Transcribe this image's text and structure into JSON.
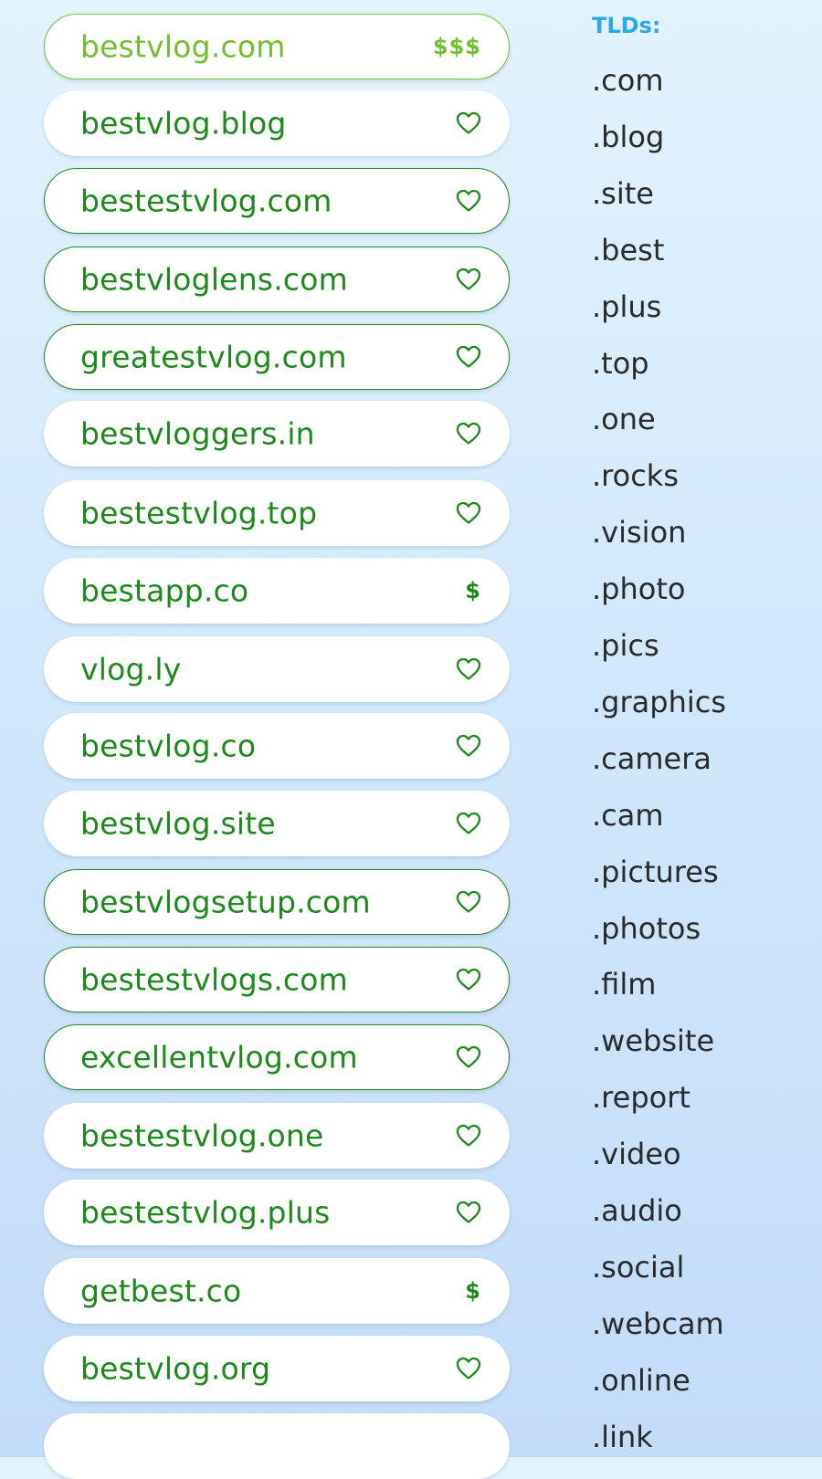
{
  "colors": {
    "domain_text": "#1b8a1b",
    "premium_text": "#72c030",
    "tld_heading": "#2ba8e8",
    "tld_text": "#2a2a2a",
    "background_top": "#e3f3fd",
    "background_bottom": "#c3dcf8"
  },
  "domains": [
    {
      "name": "bestvlog.com",
      "icon": "price-tag",
      "price": "$$$",
      "style": "premium"
    },
    {
      "name": "bestvlog.blog",
      "icon": "heart-icon",
      "style": "plain"
    },
    {
      "name": "bestestvlog.com",
      "icon": "heart-icon",
      "style": "outlined"
    },
    {
      "name": "bestvloglens.com",
      "icon": "heart-icon",
      "style": "outlined"
    },
    {
      "name": "greatestvlog.com",
      "icon": "heart-icon",
      "style": "outlined"
    },
    {
      "name": "bestvloggers.in",
      "icon": "heart-icon",
      "style": "plain"
    },
    {
      "name": "bestestvlog.top",
      "icon": "heart-icon",
      "style": "plain"
    },
    {
      "name": "bestapp.co",
      "icon": "price-tag",
      "price": "$",
      "style": "plain"
    },
    {
      "name": "vlog.ly",
      "icon": "heart-icon",
      "style": "plain"
    },
    {
      "name": "bestvlog.co",
      "icon": "heart-icon",
      "style": "plain"
    },
    {
      "name": "bestvlog.site",
      "icon": "heart-icon",
      "style": "plain"
    },
    {
      "name": "bestvlogsetup.com",
      "icon": "heart-icon",
      "style": "outlined"
    },
    {
      "name": "bestestvlogs.com",
      "icon": "heart-icon",
      "style": "outlined"
    },
    {
      "name": "excellentvlog.com",
      "icon": "heart-icon",
      "style": "outlined"
    },
    {
      "name": "bestestvlog.one",
      "icon": "heart-icon",
      "style": "plain"
    },
    {
      "name": "bestestvlog.plus",
      "icon": "heart-icon",
      "style": "plain"
    },
    {
      "name": "getbest.co",
      "icon": "price-tag",
      "price": "$",
      "style": "plain"
    },
    {
      "name": "bestvlog.org",
      "icon": "heart-icon",
      "style": "plain"
    },
    {
      "name": "",
      "icon": "none",
      "style": "plain"
    }
  ],
  "tld_panel": {
    "heading": "TLDs:",
    "items": [
      ".com",
      ".blog",
      ".site",
      ".best",
      ".plus",
      ".top",
      ".one",
      ".rocks",
      ".vision",
      ".photo",
      ".pics",
      ".graphics",
      ".camera",
      ".cam",
      ".pictures",
      ".photos",
      ".film",
      ".website",
      ".report",
      ".video",
      ".audio",
      ".social",
      ".webcam",
      ".online",
      ".link"
    ]
  }
}
